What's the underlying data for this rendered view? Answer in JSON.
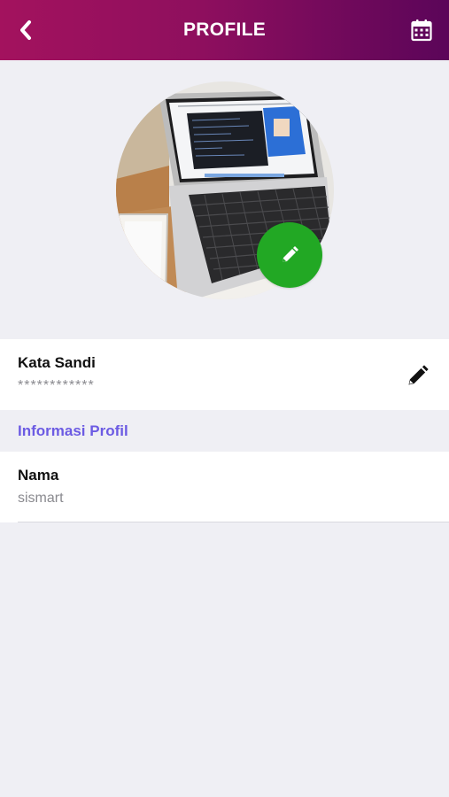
{
  "header": {
    "title": "PROFILE",
    "back_icon": "chevron-left-icon",
    "calendar_icon": "calendar-icon",
    "gradient_colors": [
      "#a3125e",
      "#5b0559"
    ]
  },
  "avatar": {
    "image_description_icon": "profile-photo",
    "edit_icon": "pencil-icon",
    "edit_button_color": "#22a824"
  },
  "password_row": {
    "label": "Kata Sandi",
    "value": "************",
    "edit_icon": "pencil-icon"
  },
  "section": {
    "title": "Informasi Profil",
    "color": "#6c5be3"
  },
  "name_row": {
    "label": "Nama",
    "value": "sismart"
  }
}
